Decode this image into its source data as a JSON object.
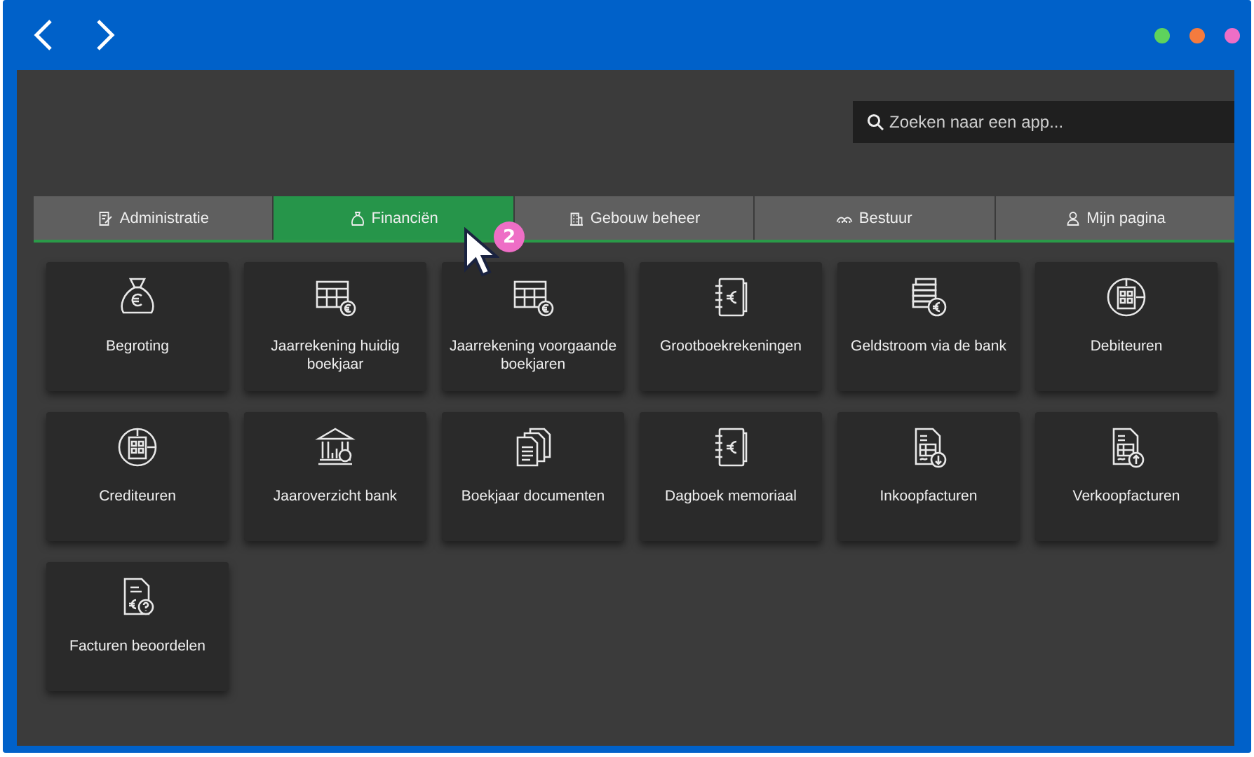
{
  "window_controls": [
    {
      "color": "#5ed35c"
    },
    {
      "color": "#f47b3e"
    },
    {
      "color": "#ee6ec6"
    }
  ],
  "search": {
    "placeholder": "Zoeken naar een app..."
  },
  "tabs": [
    {
      "label": "Administratie",
      "kind": "edit",
      "selected": false
    },
    {
      "label": "Financiën",
      "kind": "bag",
      "selected": true
    },
    {
      "label": "Gebouw beheer",
      "kind": "building",
      "selected": false
    },
    {
      "label": "Bestuur",
      "kind": "people",
      "selected": false
    },
    {
      "label": "Mijn pagina",
      "kind": "person",
      "selected": false
    }
  ],
  "step_badge": "2",
  "apps": [
    {
      "label": "Begroting",
      "kind": "bag"
    },
    {
      "label": "Jaarrekening huidig boekjaar",
      "kind": "table"
    },
    {
      "label": "Jaarrekening voorgaande boekjaren",
      "kind": "table"
    },
    {
      "label": "Grootboekrekeningen",
      "kind": "notebook"
    },
    {
      "label": "Geldstroom via de bank",
      "kind": "coins"
    },
    {
      "label": "Debiteuren",
      "kind": "calculator"
    },
    {
      "label": "Crediteuren",
      "kind": "calculator"
    },
    {
      "label": "Jaaroverzicht bank",
      "kind": "bank"
    },
    {
      "label": "Boekjaar documenten",
      "kind": "documents"
    },
    {
      "label": "Dagboek memoriaal",
      "kind": "notebook"
    },
    {
      "label": "Inkoopfacturen",
      "kind": "invoice-down"
    },
    {
      "label": "Verkoopfacturen",
      "kind": "invoice-up"
    },
    {
      "label": "Facturen beoordelen",
      "kind": "invoice-question"
    }
  ]
}
